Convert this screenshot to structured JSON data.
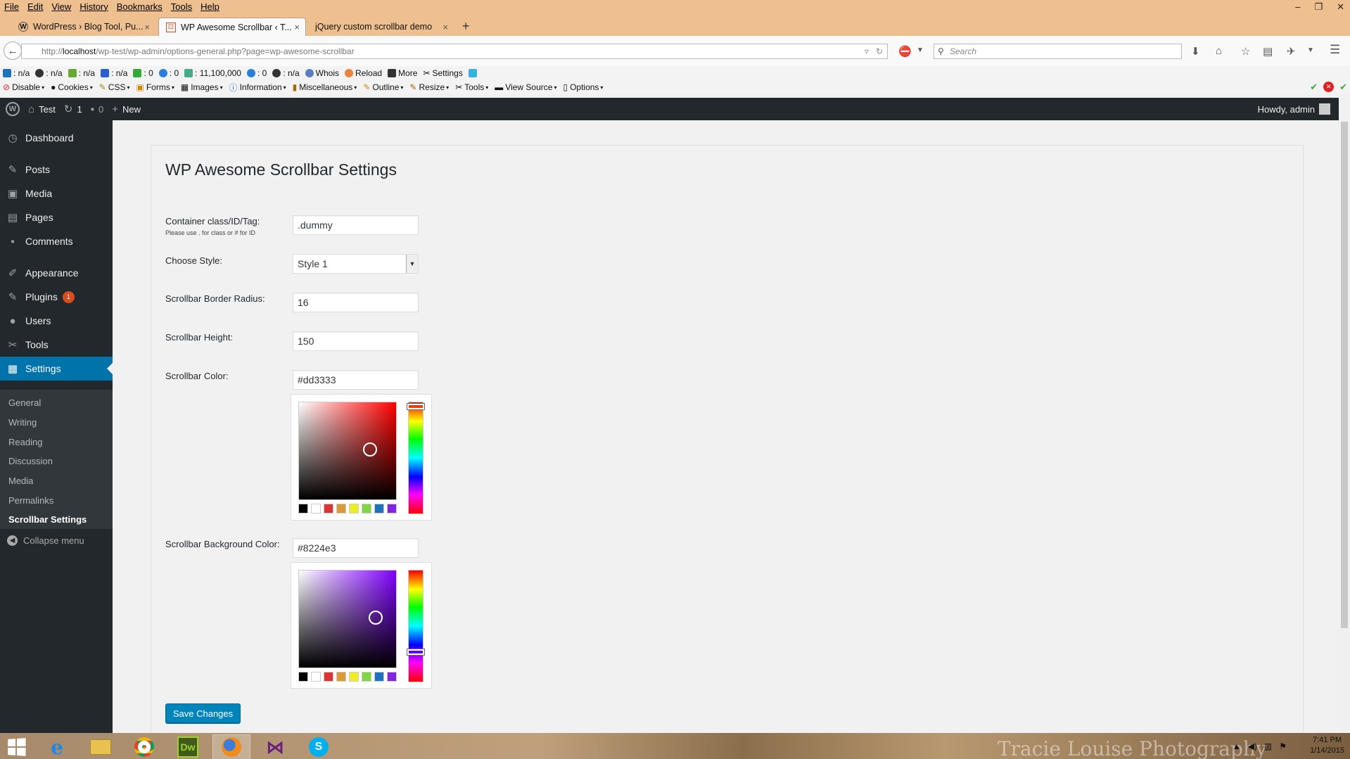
{
  "browser": {
    "menu": [
      "File",
      "Edit",
      "View",
      "History",
      "Bookmarks",
      "Tools",
      "Help"
    ],
    "window_buttons": [
      "–",
      "❐",
      "✕"
    ],
    "tabs": [
      {
        "title": "WordPress › Blog Tool, Pu...",
        "close": "×"
      },
      {
        "title": "WP Awesome Scrollbar ‹ T...",
        "close": "×"
      },
      {
        "title": "jQuery custom scrollbar demo",
        "close": "×"
      }
    ],
    "new_tab": "+",
    "url": {
      "prefix": "http://",
      "host": "localhost",
      "path": "/wp-test/wp-admin/options-general.php?page=wp-awesome-scrollbar"
    },
    "search_placeholder": "Search",
    "addon_toolbar": [
      ": n/a",
      ": n/a",
      ": n/a",
      ": n/a",
      ": 0",
      ": 0",
      ": 11,100,000",
      ": 0",
      ": n/a",
      "Whois",
      "Reload",
      "More",
      "Settings"
    ],
    "webdev_toolbar": [
      "Disable",
      "Cookies",
      "CSS",
      "Forms",
      "Images",
      "Information",
      "Miscellaneous",
      "Outline",
      "Resize",
      "Tools",
      "View Source",
      "Options"
    ]
  },
  "adminbar": {
    "site": "Test",
    "updates": "1",
    "comments": "0",
    "new": "New",
    "howdy": "Howdy, admin"
  },
  "sidebar": {
    "items": [
      {
        "label": "Dashboard",
        "icon": "dashboard-icon"
      },
      {
        "label": "Posts",
        "icon": "pin-icon"
      },
      {
        "label": "Media",
        "icon": "media-icon"
      },
      {
        "label": "Pages",
        "icon": "pages-icon"
      },
      {
        "label": "Comments",
        "icon": "comment-icon"
      },
      {
        "label": "Appearance",
        "icon": "brush-icon"
      },
      {
        "label": "Plugins",
        "icon": "plug-icon",
        "badge": "1"
      },
      {
        "label": "Users",
        "icon": "user-icon"
      },
      {
        "label": "Tools",
        "icon": "wrench-icon"
      },
      {
        "label": "Settings",
        "icon": "settings-icon"
      }
    ],
    "submenu": [
      "General",
      "Writing",
      "Reading",
      "Discussion",
      "Media",
      "Permalinks",
      "Scrollbar Settings"
    ],
    "collapse": "Collapse menu"
  },
  "main": {
    "title": "WP Awesome Scrollbar Settings",
    "fields": {
      "container": {
        "label": "Container class/ID/Tag:",
        "hint": "Please use . for class or # for ID",
        "value": ".dummy"
      },
      "style": {
        "label": "Choose Style:",
        "value": "Style 1"
      },
      "radius": {
        "label": "Scrollbar Border Radius:",
        "value": "16"
      },
      "height": {
        "label": "Scrollbar Height:",
        "value": "150"
      },
      "color": {
        "label": "Scrollbar Color:",
        "value": "#dd3333"
      },
      "bgcolor": {
        "label": "Scrollbar Background Color:",
        "value": "#8224e3"
      }
    },
    "save": "Save Changes"
  },
  "picker_palette": [
    "#000000",
    "#ffffff",
    "#dd3333",
    "#dd9933",
    "#eeee22",
    "#81d742",
    "#1e73be",
    "#8224e3"
  ],
  "taskbar": {
    "time": "7:41 PM",
    "date": "1/14/2015",
    "wallpaper_text": "Tracie Louise Photography"
  }
}
